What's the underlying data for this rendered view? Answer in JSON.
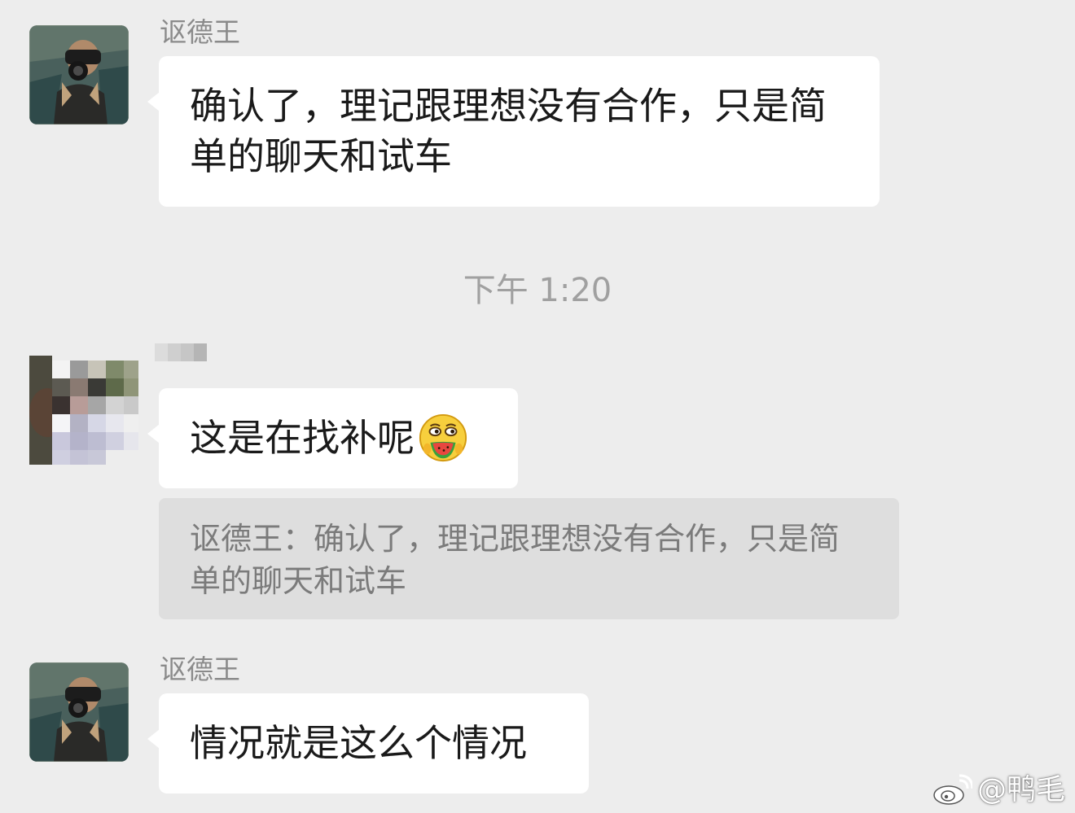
{
  "chat": {
    "messages": [
      {
        "sender": "讴德王",
        "text": "确认了，理记跟理想没有合作，只是简单的聊天和试车"
      },
      {
        "text": "这是在找补呢",
        "emoji": "watermelon-grin-emoji",
        "quote": "讴德王：确认了，理记跟理想没有合作，只是简单的聊天和试车"
      },
      {
        "sender": "讴德王",
        "text": "情况就是这么个情况"
      }
    ],
    "timestamp": "下午 1:20"
  },
  "watermark": {
    "text": "@鸭毛",
    "icon": "weibo-icon"
  },
  "colors": {
    "background": "#ededed",
    "bubble": "#ffffff",
    "quote_background": "#dedede",
    "name_text": "#8a8a8a",
    "quote_text": "#7b7b7b",
    "timestamp_text": "#a0a0a0"
  }
}
